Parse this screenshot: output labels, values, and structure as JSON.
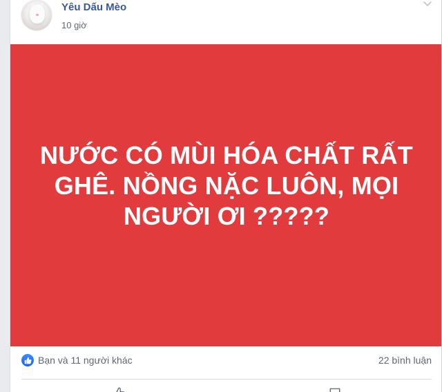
{
  "post": {
    "page_name": "Yêu Dấu Mèo",
    "time": "10 giờ",
    "image_text": "NƯỚC CÓ MÙI HÓA CHẤT RẤT GHÊ. NỒNG NẶC LUÔN, MỌI NGƯỜI ƠI ?????",
    "image_background": "#e13b3e",
    "reactions_summary": "Bạn và 11 người khác",
    "comment_count": "22 bình luận"
  },
  "colors": {
    "link": "#385898",
    "like_blue": "#1877f2"
  },
  "icons": {
    "options": "chevron-down-icon",
    "reaction": "like-badge-icon",
    "like_action": "thumbs-up-icon",
    "comment_action": "comment-icon"
  }
}
